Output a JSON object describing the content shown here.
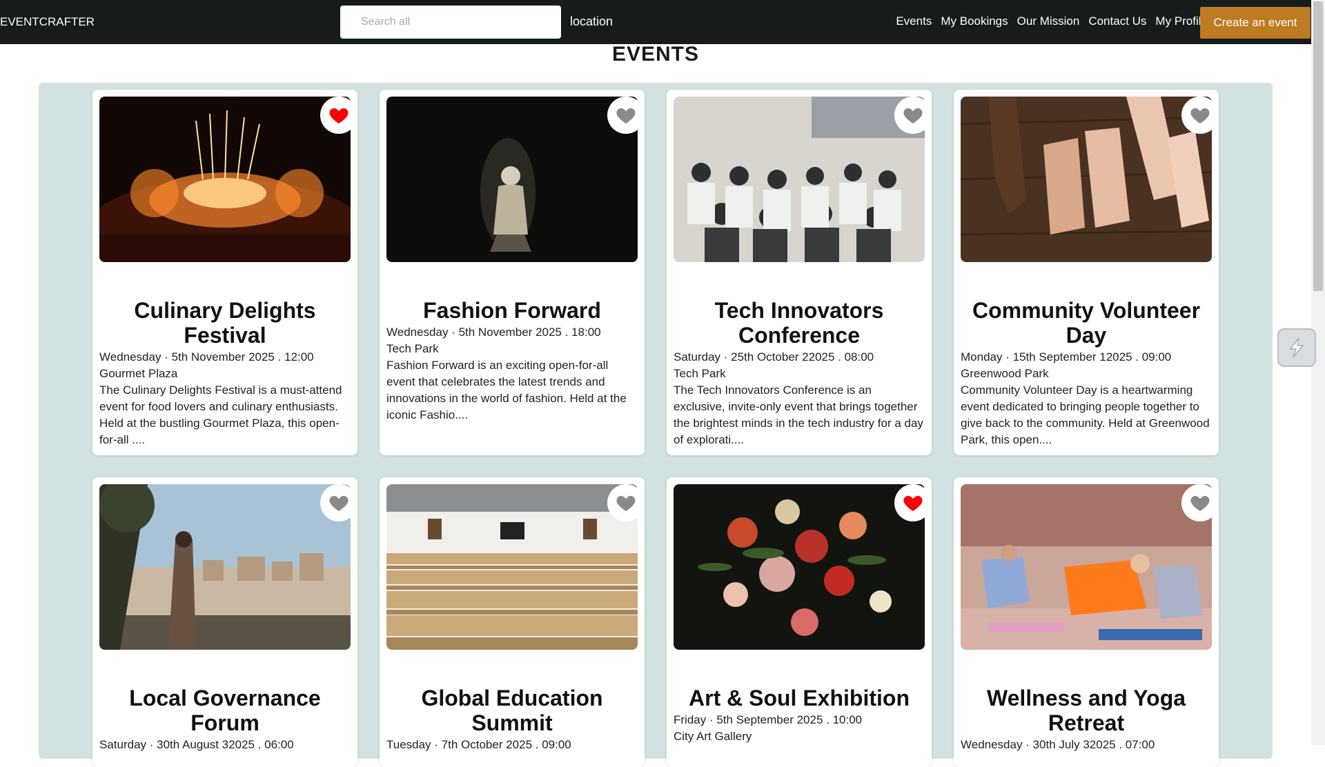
{
  "navbar": {
    "brand": "EVENTCRAFTER",
    "search_placeholder": "Search all",
    "location_label": "location",
    "links": [
      "Events",
      "My Bookings",
      "Our Mission",
      "Contact Us",
      "My Profile"
    ],
    "create_button": "Create an event"
  },
  "page": {
    "title": "EVENTS"
  },
  "colors": {
    "navbar": "#161b1c",
    "accent": "#bd7b22",
    "panel": "#d2e2e0",
    "heart_active": "#ff0000",
    "heart_inactive": "#8a8a8a"
  },
  "events": [
    {
      "title": "Culinary Delights Festival",
      "date": "Wednesday · 5th November 2025 . 12:00",
      "venue": "Gourmet Plaza",
      "description": "The Culinary Delights Festival is a must-attend event for food lovers and culinary enthusiasts. Held at the bustling Gourmet Plaza, this open-for-all ....",
      "favorited": true,
      "image": "fireworks-concert"
    },
    {
      "title": "Fashion Forward",
      "date": "Wednesday · 5th November 2025 . 18:00",
      "venue": "Tech Park",
      "description": "Fashion Forward is an exciting open-for-all event that celebrates the latest trends and innovations in the world of fashion. Held at the iconic Fashio....",
      "favorited": false,
      "image": "runway-model"
    },
    {
      "title": "Tech Innovators Conference",
      "date": "Saturday · 25th October 22025 . 08:00",
      "venue": "Tech Park",
      "description": "The Tech Innovators Conference is an exclusive, invite-only event that brings together the brightest minds in the tech industry for a day of explorati....",
      "favorited": false,
      "image": "conference-audience"
    },
    {
      "title": "Community Volunteer Day",
      "date": "Monday · 15th September 12025 . 09:00",
      "venue": "Greenwood Park",
      "description": "Community Volunteer Day is a heartwarming event dedicated to bringing people together to give back to the community. Held at Greenwood Park, this open....",
      "favorited": false,
      "image": "hands-on-table"
    },
    {
      "title": "Local Governance Forum",
      "date": "Saturday · 30th August 32025 . 06:00",
      "venue": "",
      "description": "",
      "favorited": false,
      "image": "woman-city-view"
    },
    {
      "title": "Global Education Summit",
      "date": "Tuesday · 7th October 2025 . 09:00",
      "venue": "",
      "description": "",
      "favorited": false,
      "image": "auditorium-seats"
    },
    {
      "title": "Art & Soul Exhibition",
      "date": "Friday · 5th September 2025 . 10:00",
      "venue": "City Art Gallery",
      "description": "",
      "favorited": true,
      "image": "flower-painting"
    },
    {
      "title": "Wellness and Yoga Retreat",
      "date": "Wednesday · 30th July 32025 . 07:00",
      "venue": "",
      "description": "",
      "favorited": false,
      "image": "yoga-class"
    }
  ]
}
